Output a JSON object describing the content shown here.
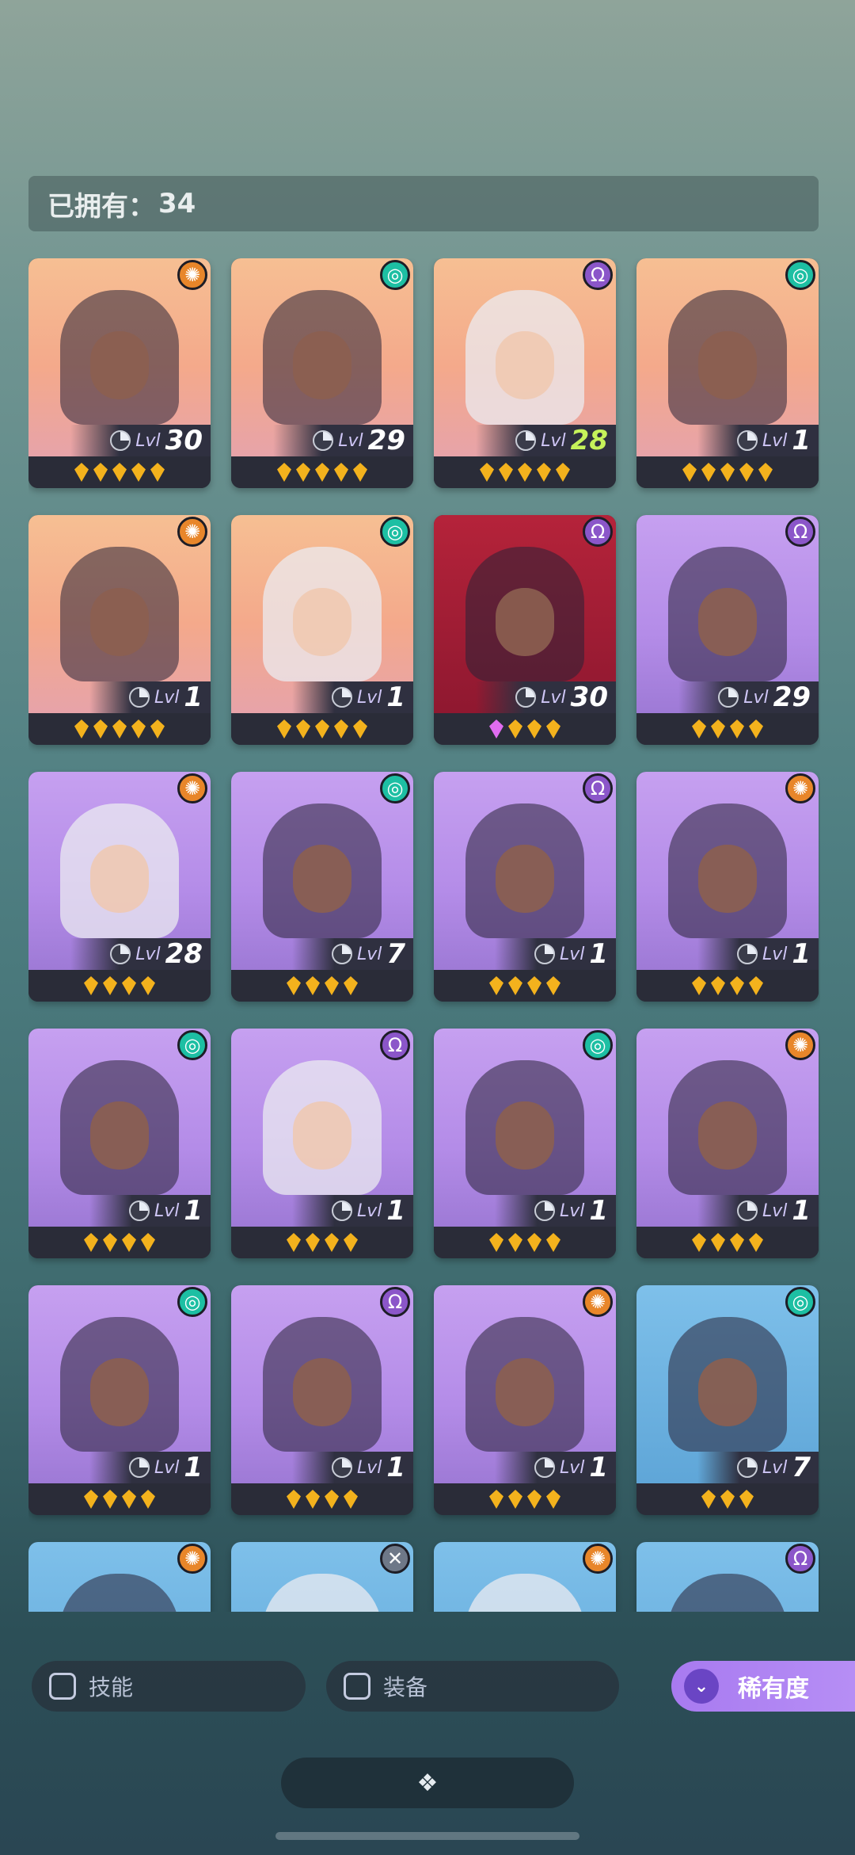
{
  "header": {
    "owned_label": "已拥有：",
    "owned_count": "34"
  },
  "cards": [
    {
      "level_label": "Lvl",
      "level": "30",
      "stars": 5,
      "element": "orange",
      "bg": "peach",
      "tone": "dark"
    },
    {
      "level_label": "Lvl",
      "level": "29",
      "stars": 5,
      "element": "teal",
      "bg": "peach",
      "tone": "dark"
    },
    {
      "level_label": "Lvl",
      "level": "28",
      "stars": 5,
      "element": "violet",
      "bg": "peach",
      "tone": "light",
      "highlight": true
    },
    {
      "level_label": "Lvl",
      "level": "1",
      "stars": 5,
      "element": "teal",
      "bg": "peach",
      "tone": "dark"
    },
    {
      "level_label": "Lvl",
      "level": "1",
      "stars": 5,
      "element": "orange",
      "bg": "peach",
      "tone": "dark"
    },
    {
      "level_label": "Lvl",
      "level": "1",
      "stars": 5,
      "element": "teal",
      "bg": "peach",
      "tone": "light"
    },
    {
      "level_label": "Lvl",
      "level": "30",
      "stars": 4,
      "pink_first": true,
      "element": "violet",
      "bg": "red",
      "tone": "dark"
    },
    {
      "level_label": "Lvl",
      "level": "29",
      "stars": 4,
      "element": "violet",
      "bg": "purple",
      "tone": "dark"
    },
    {
      "level_label": "Lvl",
      "level": "28",
      "stars": 4,
      "element": "orange",
      "bg": "purple",
      "tone": "light"
    },
    {
      "level_label": "Lvl",
      "level": "7",
      "stars": 4,
      "element": "teal",
      "bg": "purple",
      "tone": "dark"
    },
    {
      "level_label": "Lvl",
      "level": "1",
      "stars": 4,
      "element": "violet",
      "bg": "purple",
      "tone": "dark"
    },
    {
      "level_label": "Lvl",
      "level": "1",
      "stars": 4,
      "element": "orange",
      "bg": "purple",
      "tone": "dark"
    },
    {
      "level_label": "Lvl",
      "level": "1",
      "stars": 4,
      "element": "teal",
      "bg": "purple",
      "tone": "dark"
    },
    {
      "level_label": "Lvl",
      "level": "1",
      "stars": 4,
      "element": "violet",
      "bg": "purple",
      "tone": "light"
    },
    {
      "level_label": "Lvl",
      "level": "1",
      "stars": 4,
      "element": "teal",
      "bg": "purple",
      "tone": "dark"
    },
    {
      "level_label": "Lvl",
      "level": "1",
      "stars": 4,
      "element": "orange",
      "bg": "purple",
      "tone": "dark"
    },
    {
      "level_label": "Lvl",
      "level": "1",
      "stars": 4,
      "element": "teal",
      "bg": "purple",
      "tone": "dark"
    },
    {
      "level_label": "Lvl",
      "level": "1",
      "stars": 4,
      "element": "violet",
      "bg": "purple",
      "tone": "dark"
    },
    {
      "level_label": "Lvl",
      "level": "1",
      "stars": 4,
      "element": "orange",
      "bg": "purple",
      "tone": "dark"
    },
    {
      "level_label": "Lvl",
      "level": "7",
      "stars": 3,
      "element": "teal",
      "bg": "blue",
      "tone": "dark"
    },
    {
      "level_label": "",
      "level": "",
      "stars": 0,
      "element": "orange",
      "bg": "blue",
      "tone": "dark"
    },
    {
      "level_label": "",
      "level": "",
      "stars": 0,
      "element": "dim",
      "bg": "blue",
      "tone": "light"
    },
    {
      "level_label": "",
      "level": "",
      "stars": 0,
      "element": "orange",
      "bg": "blue",
      "tone": "light"
    },
    {
      "level_label": "",
      "level": "",
      "stars": 0,
      "element": "violet",
      "bg": "blue",
      "tone": "dark"
    }
  ],
  "filters": {
    "skill_label": "技能",
    "equipment_label": "装备",
    "rarity_label": "稀有度"
  },
  "icons": {
    "rarity_sort": "double-chevron-down-icon",
    "collapse": "diamond-cluster-icon"
  }
}
